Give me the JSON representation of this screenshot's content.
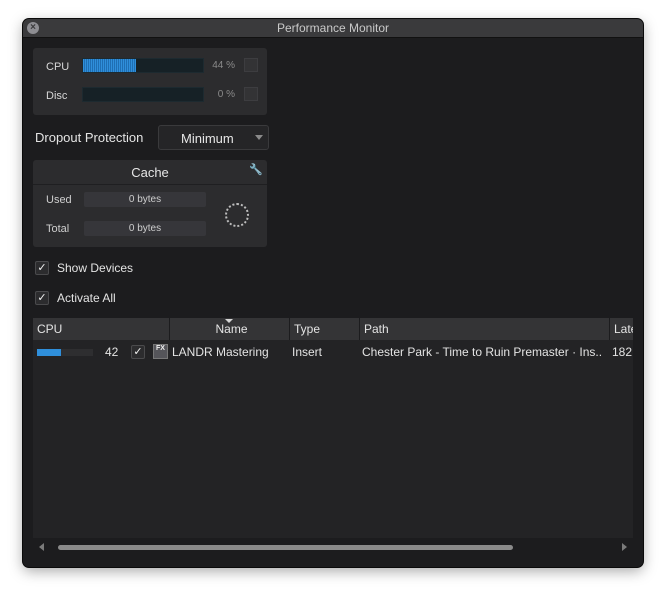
{
  "window": {
    "title": "Performance Monitor"
  },
  "meters": {
    "cpu": {
      "label": "CPU",
      "percent_text": "44 %",
      "level": 0.44
    },
    "disc": {
      "label": "Disc",
      "percent_text": "0 %",
      "level": 0.0
    }
  },
  "dropout": {
    "label": "Dropout Protection",
    "value": "Minimum"
  },
  "cache": {
    "title": "Cache",
    "used_label": "Used",
    "used_value": "0 bytes",
    "total_label": "Total",
    "total_value": "0 bytes"
  },
  "options": {
    "show_devices": {
      "label": "Show Devices",
      "checked": true,
      "mark": "✓"
    },
    "activate_all": {
      "label": "Activate All",
      "checked": true,
      "mark": "✓"
    }
  },
  "table": {
    "columns": [
      "CPU",
      "Name",
      "Type",
      "Path",
      "Late"
    ],
    "rows": [
      {
        "cpu_value": "42",
        "cpu_level": 0.42,
        "active_mark": "✓",
        "icon_text": "FX",
        "name": "LANDR Mastering",
        "type": "Insert",
        "path": "Chester Park - Time to Ruin Premaster · Ins..",
        "latency": "182"
      }
    ]
  },
  "icons": {
    "close": "close-icon",
    "wrench": "wrench-icon",
    "spinner": "spinner-icon",
    "fx": "fx-plugin-icon"
  },
  "colors": {
    "accent": "#2f8fdb",
    "background": "#1c1c1e",
    "panel": "#2c2c2e"
  }
}
